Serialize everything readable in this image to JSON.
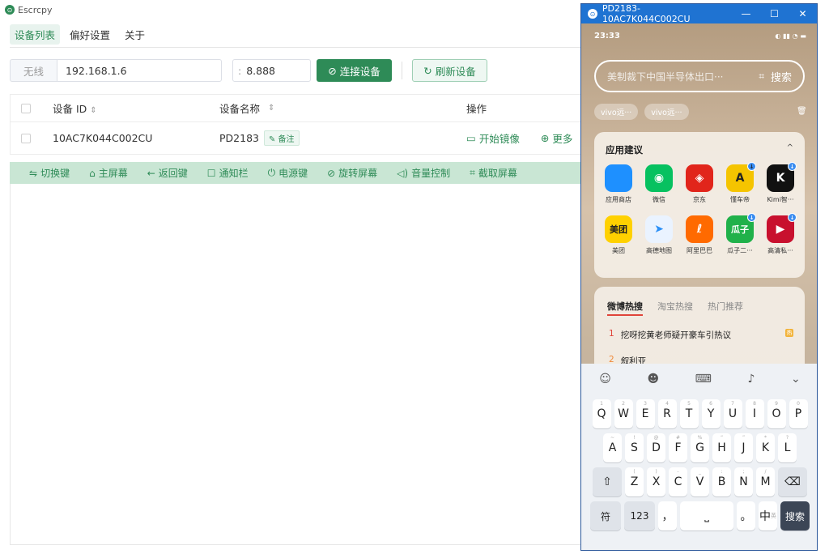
{
  "app": {
    "title": "Escrcpy"
  },
  "tabs": [
    {
      "label": "设备列表"
    },
    {
      "label": "偏好设置"
    },
    {
      "label": "关于"
    }
  ],
  "connect": {
    "addon": "无线",
    "ip_value": "192.168.1.6",
    "port_colon": ":",
    "port_value": "8.888",
    "connect_label": "连接设备",
    "refresh_label": "刷新设备"
  },
  "table": {
    "headers": {
      "id": "设备 ID",
      "name": "设备名称",
      "op": "操作"
    },
    "row": {
      "id": "10AC7K044C002CU",
      "name": "PD2183",
      "tag": "备注",
      "mirror": "开始镜像",
      "more": "更多"
    }
  },
  "toolbar": [
    {
      "label": "切换键"
    },
    {
      "label": "主屏幕"
    },
    {
      "label": "返回键"
    },
    {
      "label": "通知栏"
    },
    {
      "label": "电源键"
    },
    {
      "label": "旋转屏幕"
    },
    {
      "label": "音量控制"
    },
    {
      "label": "截取屏幕"
    }
  ],
  "phone": {
    "window_title": "PD2183-10AC7K044C002CU",
    "time": "23:33",
    "search_placeholder": "美制裁下中国半导体出口···",
    "search_button": "搜索",
    "chips": [
      "vivo远···",
      "vivo远···"
    ],
    "suggest_title": "应用建议",
    "apps": [
      {
        "label": "应用商店",
        "icon_text": "",
        "color": "#1e90ff"
      },
      {
        "label": "微信",
        "icon_text": "",
        "color": "#07c160"
      },
      {
        "label": "京东",
        "icon_text": "",
        "color": "#e1251b"
      },
      {
        "label": "懂车帝",
        "icon_text": "",
        "color": "#f5c400"
      },
      {
        "label": "Kimi智···",
        "icon_text": "K",
        "color": "#111111"
      },
      {
        "label": "美团",
        "icon_text": "美团",
        "color": "#ffd100"
      },
      {
        "label": "高德地图",
        "icon_text": "",
        "color": "#2a8ff7"
      },
      {
        "label": "阿里巴巴",
        "icon_text": "",
        "color": "#ff6a00"
      },
      {
        "label": "瓜子二···",
        "icon_text": "瓜子",
        "color": "#20b14a"
      },
      {
        "label": "高清私···",
        "icon_text": "",
        "color": "#c8102e"
      }
    ],
    "hot_tabs": [
      "微博热搜",
      "淘宝热搜",
      "热门推荐"
    ],
    "hot_items": [
      {
        "num": "1",
        "text": "挖呀挖黄老师疑开豪车引热议"
      },
      {
        "num": "2",
        "text": "叙利亚"
      }
    ],
    "keyboard": {
      "row1": [
        {
          "k": "Q",
          "s": "1"
        },
        {
          "k": "W",
          "s": "2"
        },
        {
          "k": "E",
          "s": "3"
        },
        {
          "k": "R",
          "s": "4"
        },
        {
          "k": "T",
          "s": "5"
        },
        {
          "k": "Y",
          "s": "6"
        },
        {
          "k": "U",
          "s": "7"
        },
        {
          "k": "I",
          "s": "8"
        },
        {
          "k": "O",
          "s": "9"
        },
        {
          "k": "P",
          "s": "0"
        }
      ],
      "row2": [
        {
          "k": "A",
          "s": "~"
        },
        {
          "k": "S",
          "s": "!"
        },
        {
          "k": "D",
          "s": "@"
        },
        {
          "k": "F",
          "s": "#"
        },
        {
          "k": "G",
          "s": "%"
        },
        {
          "k": "H",
          "s": "“"
        },
        {
          "k": "J",
          "s": "”"
        },
        {
          "k": "K",
          "s": "*"
        },
        {
          "k": "L",
          "s": "?"
        }
      ],
      "row3": [
        {
          "k": "Z",
          "s": "("
        },
        {
          "k": "X",
          "s": ")"
        },
        {
          "k": "C",
          "s": "-"
        },
        {
          "k": "V",
          "s": "_"
        },
        {
          "k": "B",
          "s": ":"
        },
        {
          "k": "N",
          "s": ";"
        },
        {
          "k": "M",
          "s": "/"
        }
      ],
      "sym": "符",
      "num": "123",
      "comma": "，",
      "period": "。",
      "lang": "中",
      "lang_sub": "英",
      "search": "搜索"
    }
  }
}
